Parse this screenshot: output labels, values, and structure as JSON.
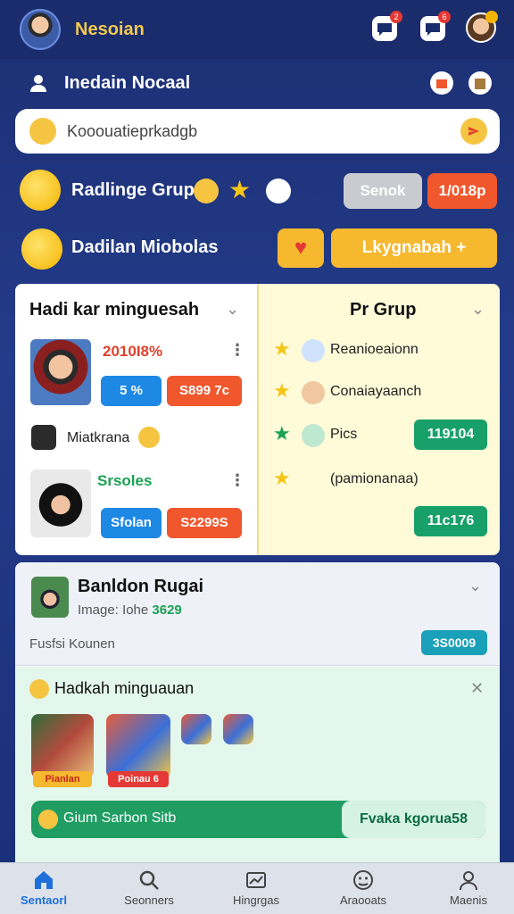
{
  "header": {
    "app_title": "Nesoian",
    "notif_count_1": "2",
    "notif_count_2": "6",
    "profile_badge": "!"
  },
  "user": {
    "name": "Inedain Nocaal"
  },
  "search": {
    "value": "Kooouatieprkadgb"
  },
  "group_row": {
    "label": "Radlinge Grup",
    "btn_grey": "Senok",
    "btn_orange": "1/018p"
  },
  "invite_row": {
    "label": "Dadilan Miobolas",
    "cta": "Lkygnabah +"
  },
  "left_panel": {
    "title": "Hadi kar minguesah",
    "items": [
      {
        "name": "2010I8%",
        "tag_blue": "5 %",
        "tag_orange": "S899 7c"
      },
      {
        "name": "Miatkrana"
      },
      {
        "name": "Srsoles",
        "tag_blue": "Sfolan",
        "tag_orange": "S2299S"
      }
    ]
  },
  "right_panel": {
    "title": "Pr Grup",
    "items": [
      {
        "text": "Reanioeaionn"
      },
      {
        "text": "Conaiayaanch"
      },
      {
        "text": "Pics",
        "value": "119104"
      },
      {
        "text": "(pamionanaa)",
        "value": "11c176"
      }
    ]
  },
  "feed": {
    "title": "Banldon Rugai",
    "meta_label": "Image: Iohe",
    "meta_value": "3629",
    "note": "Fusfsi Kounen",
    "pill": "3S0009"
  },
  "games": {
    "title": "Hadkah minguauan",
    "cap_1": "Pianlan",
    "cap_2": "Poinau 6",
    "bar_left": "Gium Sarbon Sitb",
    "bar_right": "Fvaka kgorua58"
  },
  "nav": [
    {
      "label": "Sentaorl"
    },
    {
      "label": "Seonners"
    },
    {
      "label": "Hingrgas"
    },
    {
      "label": "Araooats"
    },
    {
      "label": "Maenis"
    }
  ],
  "colors": {
    "brand_yellow": "#f2c94c",
    "accent_orange": "#f0572d",
    "accent_green": "#18a06a",
    "nav_active": "#1e6fd9"
  }
}
